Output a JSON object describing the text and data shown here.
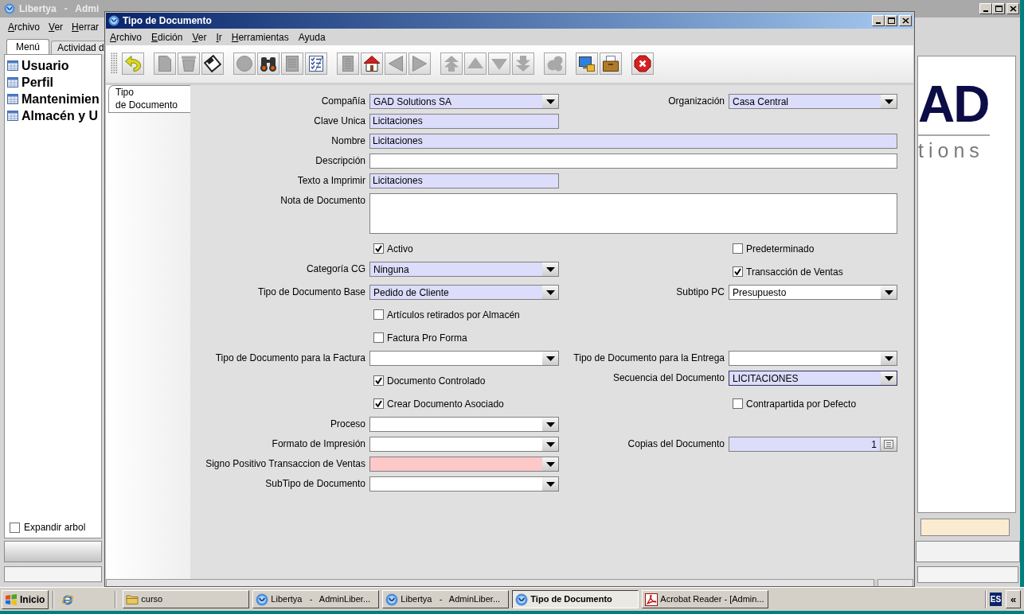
{
  "background_window": {
    "title": "Libertya   -   Admi",
    "menu": [
      {
        "label": "Archivo",
        "mnemonic": true
      },
      {
        "label": "Ver",
        "mnemonic": true
      },
      {
        "label": "Herrar",
        "mnemonic": true
      }
    ],
    "tabs": [
      {
        "label": "Menú",
        "selected": true
      },
      {
        "label": "Actividad d",
        "selected": false
      }
    ],
    "tree": [
      {
        "label": "Usuario"
      },
      {
        "label": "Perfil"
      },
      {
        "label": "Mantenimien"
      },
      {
        "label": "Almacén y U"
      }
    ],
    "expand_tree": {
      "label": "Expandir arbol",
      "checked": false
    },
    "logo": {
      "mark": "AD",
      "tagline": "tions"
    }
  },
  "window": {
    "title": "Tipo de Documento",
    "menu": [
      {
        "label": "Archivo",
        "mnemonic": true
      },
      {
        "label": "Edición",
        "mnemonic": true
      },
      {
        "label": "Ver",
        "mnemonic": true
      },
      {
        "label": "Ir",
        "mnemonic": true
      },
      {
        "label": "Herramientas",
        "mnemonic": true
      },
      {
        "label": "Ayuda",
        "mnemonic": false
      }
    ],
    "toolbar": [
      [
        {
          "kind": "undo",
          "disabled": false
        }
      ],
      [
        {
          "kind": "new",
          "disabled": true
        },
        {
          "kind": "delete",
          "disabled": true
        },
        {
          "kind": "save",
          "disabled": false
        }
      ],
      [
        {
          "kind": "refresh",
          "disabled": true
        },
        {
          "kind": "find",
          "disabled": false
        },
        {
          "kind": "attachment",
          "disabled": true
        },
        {
          "kind": "grid",
          "disabled": false
        }
      ],
      [
        {
          "kind": "history",
          "disabled": true
        },
        {
          "kind": "home",
          "disabled": false
        },
        {
          "kind": "previous",
          "disabled": true
        },
        {
          "kind": "next",
          "disabled": true
        }
      ],
      [
        {
          "kind": "first",
          "disabled": true
        },
        {
          "kind": "up",
          "disabled": true
        },
        {
          "kind": "down",
          "disabled": true
        },
        {
          "kind": "last",
          "disabled": true
        }
      ],
      [
        {
          "kind": "report",
          "disabled": true
        }
      ],
      [
        {
          "kind": "export",
          "disabled": false
        },
        {
          "kind": "archive",
          "disabled": false
        }
      ],
      [
        {
          "kind": "close",
          "disabled": false
        }
      ]
    ],
    "side_tabs": [
      {
        "lines": [
          "Tipo",
          "de Documento"
        ],
        "selected": true
      }
    ],
    "form_rows": [
      {
        "left": {
          "kind": "combo",
          "label": "Compañía",
          "value": "GAD Solutions SA",
          "required": true
        },
        "right": {
          "kind": "combo",
          "label": "Organización",
          "value": "Casa Central",
          "required": true
        }
      },
      {
        "left": {
          "kind": "text",
          "label": "Clave Unica",
          "value": "Licitaciones",
          "required": true
        }
      },
      {
        "left": {
          "kind": "wide_text",
          "label": "Nombre",
          "value": "Licitaciones",
          "required": true
        }
      },
      {
        "left": {
          "kind": "wide_text",
          "label": "Descripción",
          "required": false
        }
      },
      {
        "left": {
          "kind": "text",
          "label": "Texto a Imprimir",
          "value": "Licitaciones",
          "required": true
        }
      },
      {
        "left": {
          "kind": "textarea",
          "label": "Nota de Documento",
          "required": false
        }
      },
      {
        "left": {
          "kind": "checkbox",
          "label": "Activo",
          "checked": true
        },
        "right": {
          "kind": "checkbox",
          "label": "Predeterminado",
          "checked": false
        }
      },
      {
        "left": {
          "kind": "combo",
          "label": "Categoría CG",
          "value": "Ninguna",
          "required": true
        },
        "right": {
          "kind": "checkbox",
          "label": "Transacción de Ventas",
          "checked": true
        }
      },
      {
        "left": {
          "kind": "combo",
          "label": "Tipo de Documento Base",
          "value": "Pedido de Cliente",
          "required": true
        },
        "right": {
          "kind": "combo",
          "label": "Subtipo PC",
          "value": "Presupuesto",
          "required": false
        }
      },
      {
        "left": {
          "kind": "checkbox",
          "label": "Artículos retirados por Almacén",
          "checked": false
        }
      },
      {
        "left": {
          "kind": "checkbox",
          "label": "Factura Pro Forma",
          "checked": false
        }
      },
      {
        "left": {
          "kind": "combo",
          "label": "Tipo de Documento para la Factura",
          "required": false
        },
        "right": {
          "kind": "combo",
          "label": "Tipo de Documento para la Entrega",
          "required": false
        }
      },
      {
        "left": {
          "kind": "checkbox",
          "label": "Documento Controlado",
          "checked": true
        },
        "right": {
          "kind": "combo",
          "label": "Secuencia del Documento",
          "value": "LICITACIONES",
          "required": true,
          "focused": true
        }
      },
      {
        "left": {
          "kind": "checkbox",
          "label": "Crear Documento Asociado",
          "checked": true
        },
        "right": {
          "kind": "checkbox",
          "label": "Contrapartida por Defecto",
          "checked": false
        }
      },
      {
        "left": {
          "kind": "combo",
          "label": "Proceso",
          "required": false
        }
      },
      {
        "left": {
          "kind": "combo",
          "label": "Formato de Impresión",
          "required": false
        },
        "right": {
          "kind": "number",
          "label": "Copias del Documento",
          "value": "1",
          "required": true
        }
      },
      {
        "left": {
          "kind": "combo",
          "label": "Signo Positivo Transaccion de Ventas",
          "error": true
        }
      },
      {
        "left": {
          "kind": "combo",
          "label": "SubTipo de Documento",
          "required": false
        }
      }
    ]
  },
  "taskbar": {
    "start": "Inicio",
    "tasks": [
      {
        "kind": "folder",
        "label": "curso",
        "selected": false
      },
      {
        "kind": "app",
        "label": "Libertya   -   AdminLiber...",
        "selected": false
      },
      {
        "kind": "app",
        "label": "Libertya   -   AdminLiber...",
        "selected": false
      },
      {
        "kind": "app",
        "label": "Tipo de Documento",
        "selected": true
      },
      {
        "kind": "pdf",
        "label": "Acrobat Reader - [Admin...",
        "selected": false
      }
    ],
    "language": "ES",
    "tray_toggle": "«"
  }
}
